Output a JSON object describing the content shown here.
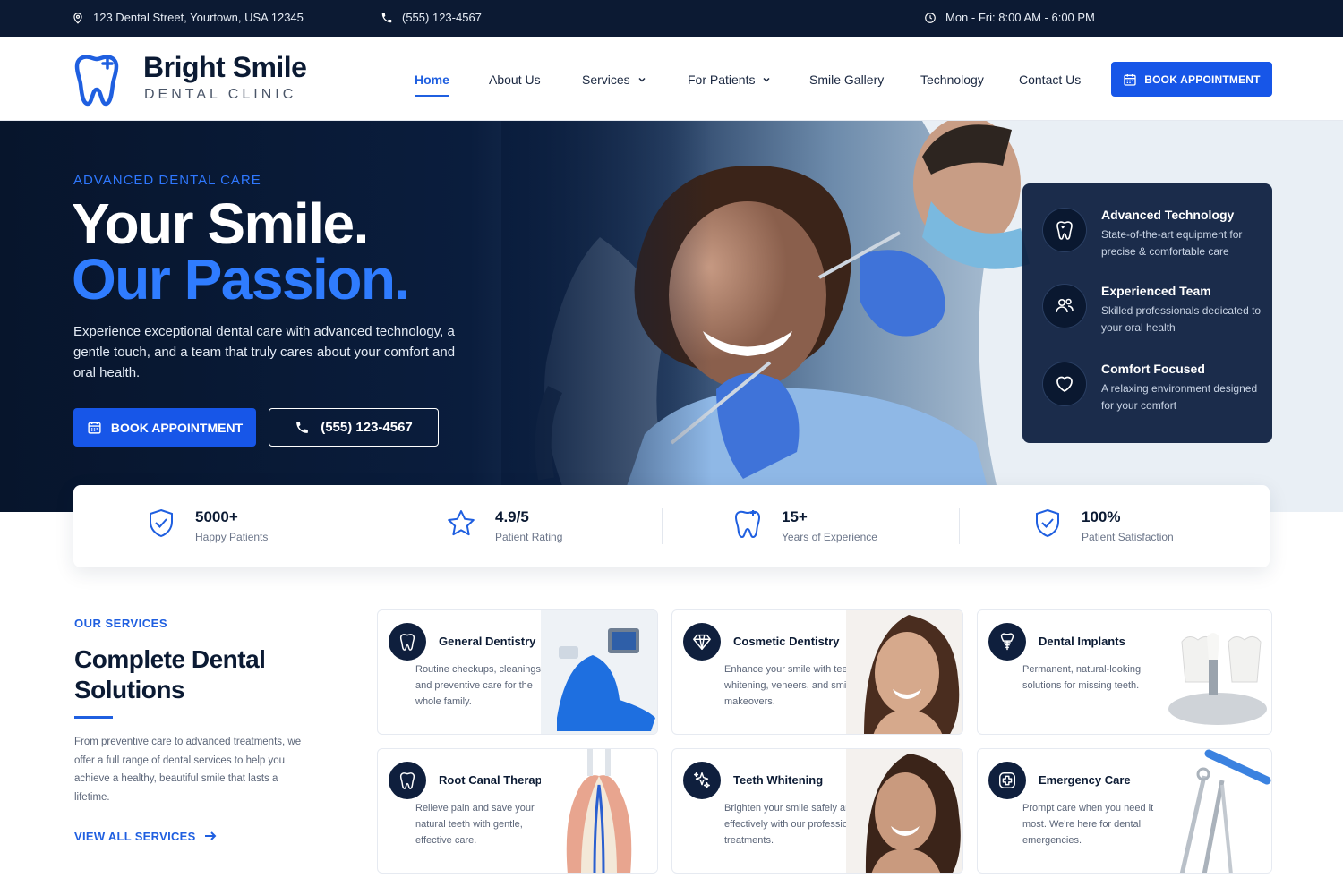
{
  "topbar": {
    "address": "123 Dental Street, Yourtown, USA 12345",
    "phone": "(555) 123-4567",
    "hours": "Mon - Fri: 8:00 AM - 6:00 PM"
  },
  "brand": {
    "name": "Bright Smile",
    "tagline": "DENTAL CLINIC",
    "accent": "#1f5fe0",
    "dark": "#0c1a33"
  },
  "nav": {
    "items": [
      {
        "label": "Home",
        "active": true
      },
      {
        "label": "About Us"
      },
      {
        "label": "Services",
        "dropdown": true
      },
      {
        "label": "For Patients",
        "dropdown": true
      },
      {
        "label": "Smile Gallery"
      },
      {
        "label": "Technology"
      },
      {
        "label": "Contact Us"
      }
    ],
    "cta": "BOOK APPOINTMENT"
  },
  "hero": {
    "kicker": "ADVANCED DENTAL CARE",
    "title_line1": "Your Smile.",
    "title_line2": "Our Passion.",
    "text": "Experience exceptional dental care with advanced technology, a gentle touch, and a team that truly cares about your comfort and oral health.",
    "cta_book": "BOOK APPOINTMENT",
    "cta_phone": "(555) 123-4567",
    "features": [
      {
        "icon": "tooth-sparkle-icon",
        "title": "Advanced Technology",
        "desc": "State-of-the-art equipment for precise & comfortable care"
      },
      {
        "icon": "team-icon",
        "title": "Experienced Team",
        "desc": "Skilled professionals dedicated to your oral health"
      },
      {
        "icon": "heart-icon",
        "title": "Comfort Focused",
        "desc": "A relaxing environment designed for your comfort"
      }
    ]
  },
  "stats": [
    {
      "icon": "shield-check-icon",
      "value": "5000+",
      "label": "Happy Patients"
    },
    {
      "icon": "star-icon",
      "value": "4.9/5",
      "label": "Patient Rating"
    },
    {
      "icon": "tooth-sparkle-icon",
      "value": "15+",
      "label": "Years of Experience"
    },
    {
      "icon": "shield-check-icon",
      "value": "100%",
      "label": "Patient Satisfaction"
    }
  ],
  "services": {
    "kicker": "OUR SERVICES",
    "title": "Complete Dental Solutions",
    "text": "From preventive care to advanced treatments, we offer a full range of dental services to help you achieve a healthy, beautiful smile that lasts a lifetime.",
    "link": "VIEW ALL SERVICES",
    "cards": [
      {
        "icon": "tooth-icon",
        "title": "General Dentistry",
        "desc": "Routine checkups, cleanings, and preventive care for the whole family."
      },
      {
        "icon": "diamond-icon",
        "title": "Cosmetic Dentistry",
        "desc": "Enhance your smile with teeth whitening, veneers, and smile makeovers."
      },
      {
        "icon": "implant-icon",
        "title": "Dental Implants",
        "desc": "Permanent, natural-looking solutions for missing teeth."
      },
      {
        "icon": "tooth-icon",
        "title": "Root Canal Therapy",
        "desc": "Relieve pain and save your natural teeth with gentle, effective care."
      },
      {
        "icon": "sparkles-icon",
        "title": "Teeth Whitening",
        "desc": "Brighten your smile safely and effectively with our professional treatments."
      },
      {
        "icon": "medical-cross-icon",
        "title": "Emergency Care",
        "desc": "Prompt care when you need it most. We're here for dental emergencies."
      }
    ]
  }
}
